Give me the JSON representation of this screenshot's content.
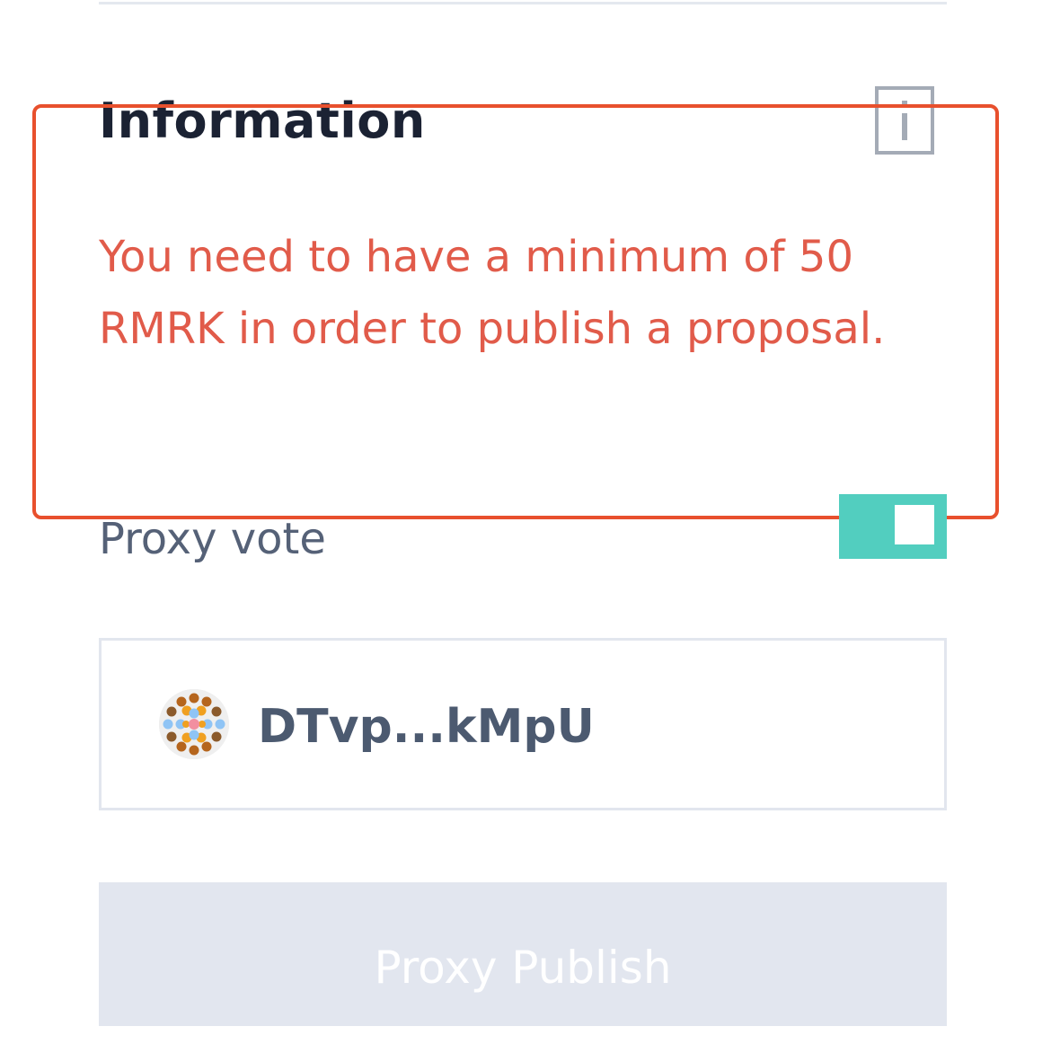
{
  "information": {
    "title": "Information",
    "icon": "info-icon",
    "message": "You need to have a minimum of 50 RMRK in order to publish a proposal."
  },
  "proxy_vote": {
    "label": "Proxy vote",
    "enabled": true
  },
  "account": {
    "address": "DTvp...kMpU",
    "avatar_icon": "identicon-avatar"
  },
  "publish_button": {
    "label": "Proxy Publish",
    "disabled": true
  },
  "colors": {
    "error_text": "#e15b4a",
    "toggle_on": "#52cebf",
    "highlight_border": "#e8502d",
    "button_disabled_bg": "#e2e6ef"
  }
}
